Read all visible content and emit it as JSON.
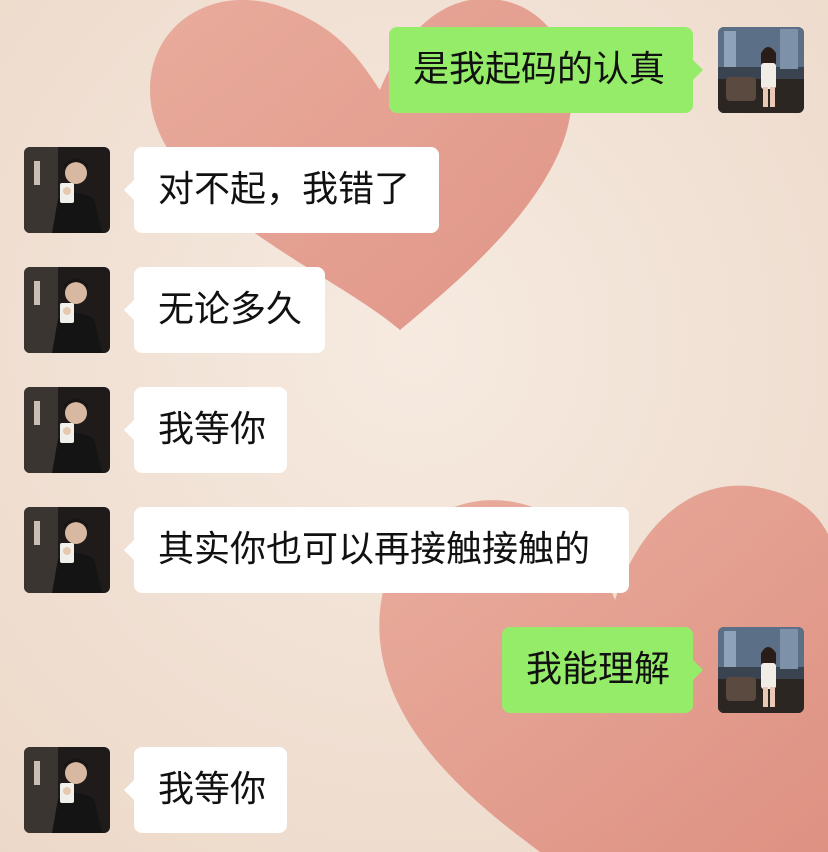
{
  "chat": {
    "messages": [
      {
        "from": "me",
        "text": "是我起码的认真"
      },
      {
        "from": "other",
        "text": "对不起，我错了"
      },
      {
        "from": "other",
        "text": "无论多久"
      },
      {
        "from": "other",
        "text": "我等你"
      },
      {
        "from": "other",
        "text": "其实你也可以再接触接触的"
      },
      {
        "from": "me",
        "text": "我能理解"
      },
      {
        "from": "other",
        "text": "我等你"
      }
    ]
  },
  "colors": {
    "background": "#f2e3d6",
    "heart": "#e0897a",
    "incoming_bubble": "#ffffff",
    "outgoing_bubble": "#95ec69"
  },
  "icons": {
    "other_avatar": "male-selfie-avatar",
    "my_avatar": "female-city-avatar"
  }
}
